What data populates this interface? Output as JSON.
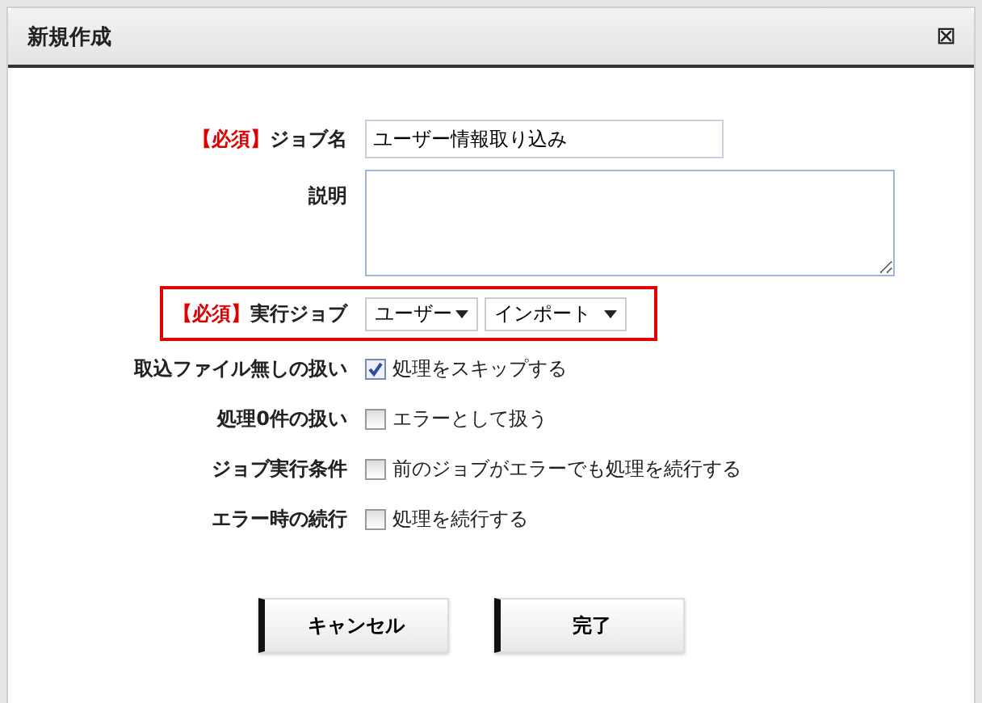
{
  "dialog": {
    "title": "新規作成",
    "close_icon": "⊠"
  },
  "fields": [
    {
      "kind": "text",
      "required": "【必須】",
      "label": "ジョブ名",
      "value": "ユーザー情報取り込み",
      "highlighted": false
    },
    {
      "kind": "textarea",
      "label": "説明",
      "highlighted": false
    },
    {
      "kind": "selects",
      "required": "【必須】",
      "label": "実行ジョブ",
      "selects": [
        "ユーザー",
        "インポート"
      ],
      "highlighted": true
    },
    {
      "kind": "checkbox",
      "label": "取込ファイル無しの扱い",
      "option": "処理をスキップする",
      "checked": true
    },
    {
      "kind": "checkbox",
      "label": "処理0件の扱い",
      "option": "エラーとして扱う",
      "checked": false
    },
    {
      "kind": "checkbox",
      "label": "ジョブ実行条件",
      "option": "前のジョブがエラーでも処理を続行する",
      "checked": false
    },
    {
      "kind": "checkbox",
      "label": "エラー時の続行",
      "option": "処理を続行する",
      "checked": false
    }
  ],
  "buttons": [
    "キャンセル",
    "完了"
  ]
}
